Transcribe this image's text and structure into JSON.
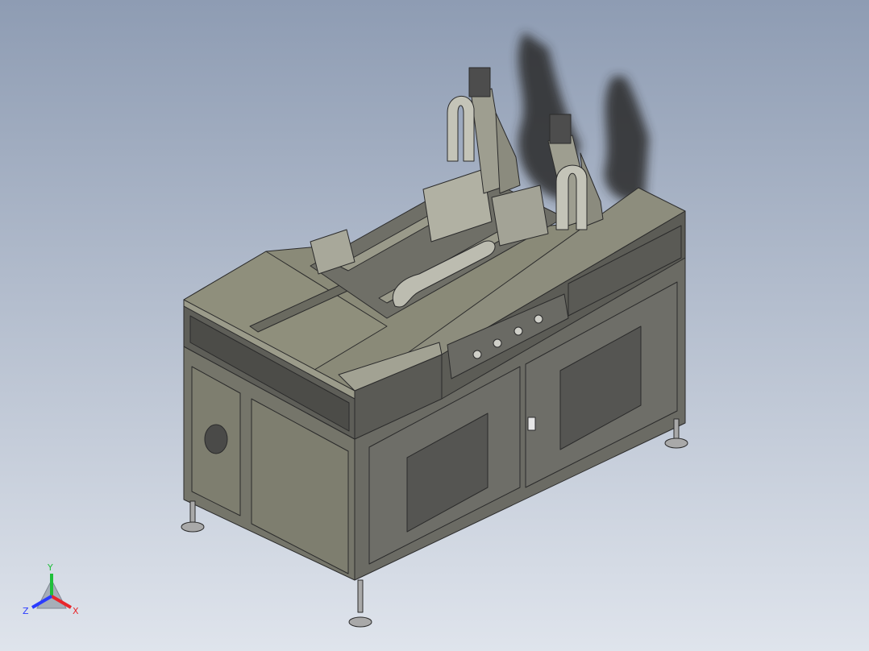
{
  "triad": {
    "x_label": "X",
    "y_label": "Y",
    "z_label": "Z",
    "x_color": "#e8262b",
    "y_color": "#1fbf3a",
    "z_color": "#2a3bff"
  },
  "colors": {
    "background_top": "#8e9cb3",
    "background_bottom": "#dfe4ec",
    "body_light": "#8a8a78",
    "body_mid": "#75756a",
    "body_dark": "#5f5f58",
    "door_panel": "#5a5a56",
    "edge": "#2b2b2b",
    "rail": "#6f6f67",
    "motor": "#4d4d4d",
    "foot": "#a9a9a9",
    "shadow": "#1e1e1e"
  }
}
